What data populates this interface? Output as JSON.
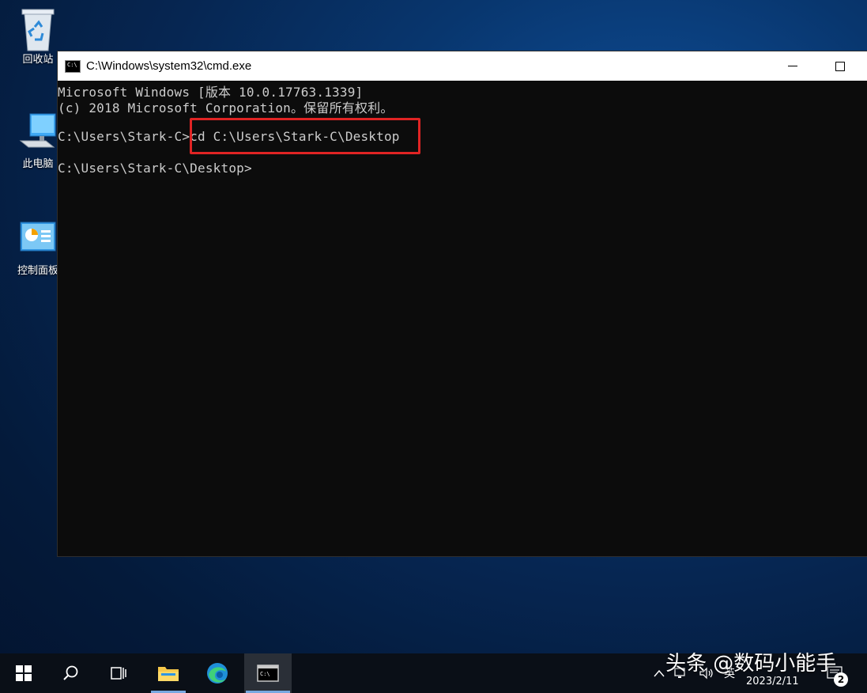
{
  "desktop": {
    "icons": [
      {
        "label": "回收站"
      },
      {
        "label": "此电脑"
      },
      {
        "label": "控制面板"
      }
    ]
  },
  "window": {
    "title": "C:\\Windows\\system32\\cmd.exe",
    "lines": [
      "Microsoft Windows [版本 10.0.17763.1339]",
      "(c) 2018 Microsoft Corporation。保留所有权利。",
      "",
      "C:\\Users\\Stark-C>cd C:\\Users\\Stark-C\\Desktop",
      "",
      "C:\\Users\\Stark-C\\Desktop>"
    ],
    "highlight_color": "#e02424"
  },
  "taskbar": {
    "date": "2023/2/11",
    "ime": "英",
    "notification_count": "2",
    "accent": "#78a8e0"
  },
  "watermark": "头条 @数码小能手"
}
